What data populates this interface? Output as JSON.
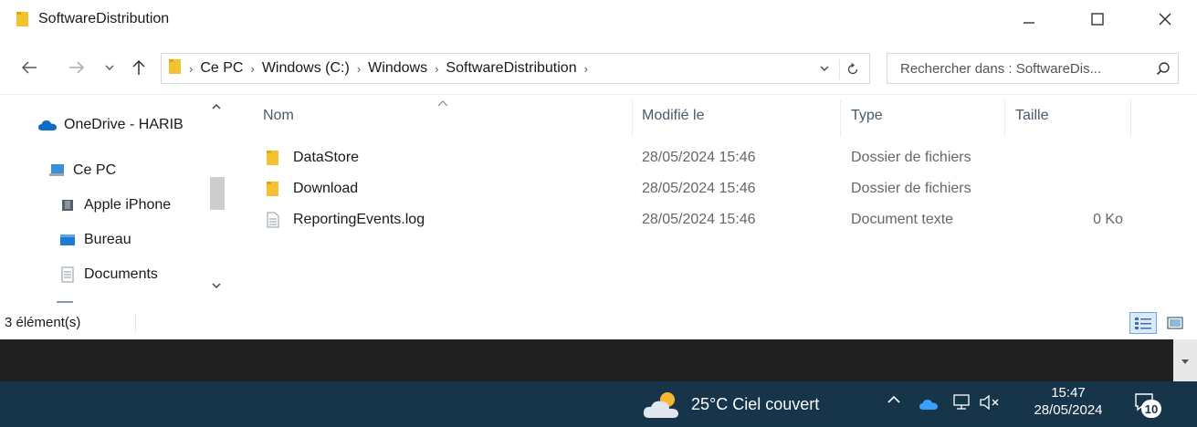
{
  "window": {
    "title": "SoftwareDistribution"
  },
  "breadcrumb": [
    "Ce PC",
    "Windows (C:)",
    "Windows",
    "SoftwareDistribution"
  ],
  "search": {
    "placeholder": "Rechercher dans : SoftwareDis..."
  },
  "navpane": {
    "items": [
      {
        "label": "OneDrive - HARIB",
        "icon": "onedrive-icon"
      },
      {
        "label": "Ce PC",
        "icon": "pc-icon"
      },
      {
        "label": "Apple iPhone",
        "icon": "phone-icon"
      },
      {
        "label": "Bureau",
        "icon": "desktop-icon"
      },
      {
        "label": "Documents",
        "icon": "documents-icon"
      }
    ]
  },
  "columns": {
    "name": "Nom",
    "modified": "Modifié le",
    "type": "Type",
    "size": "Taille"
  },
  "files": [
    {
      "name": "DataStore",
      "modified": "28/05/2024 15:46",
      "type": "Dossier de fichiers",
      "size": "",
      "icon": "folder-icon"
    },
    {
      "name": "Download",
      "modified": "28/05/2024 15:46",
      "type": "Dossier de fichiers",
      "size": "",
      "icon": "folder-icon"
    },
    {
      "name": "ReportingEvents.log",
      "modified": "28/05/2024 15:46",
      "type": "Document texte",
      "size": "0 Ko",
      "icon": "text-file-icon"
    }
  ],
  "status": {
    "count": "3 élément(s)"
  },
  "taskbar": {
    "weather": "25°C  Ciel couvert",
    "time": "15:47",
    "date": "28/05/2024",
    "notifications": "10"
  },
  "colors": {
    "folder": "#f2c230",
    "accent": "#0078d7",
    "taskbar": "#16344a"
  }
}
